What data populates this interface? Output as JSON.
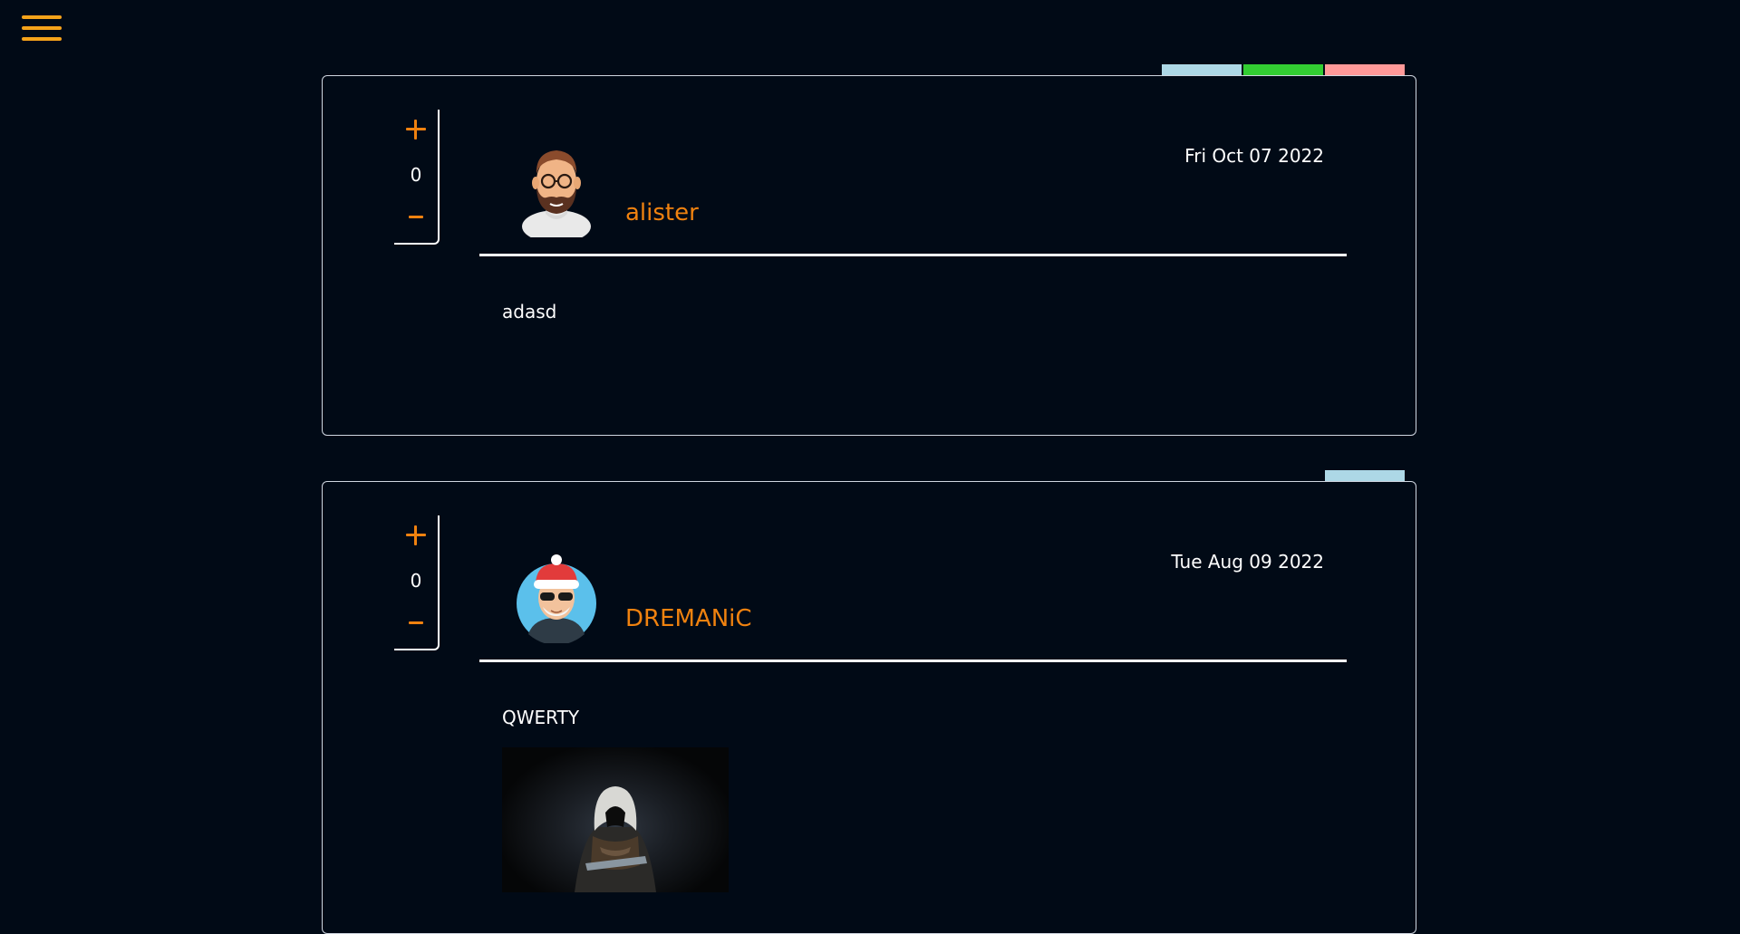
{
  "nav": {
    "menu_icon": "hamburger-menu-icon"
  },
  "colors": {
    "background": "#010a16",
    "accent": "#f0820f",
    "menu": "#f5a31a",
    "tab_blue": "#add8e6",
    "tab_green": "#32cd32",
    "tab_red": "#ff9999"
  },
  "posts": [
    {
      "username": "alister",
      "date": "Fri Oct 07 2022",
      "votes": "0",
      "content": "adasd",
      "tabs": [
        "blue",
        "green",
        "red"
      ]
    },
    {
      "username": "DREMANiC",
      "date": "Tue Aug 09 2022",
      "votes": "0",
      "content": "QWERTY",
      "tabs": [
        "blue"
      ]
    }
  ]
}
